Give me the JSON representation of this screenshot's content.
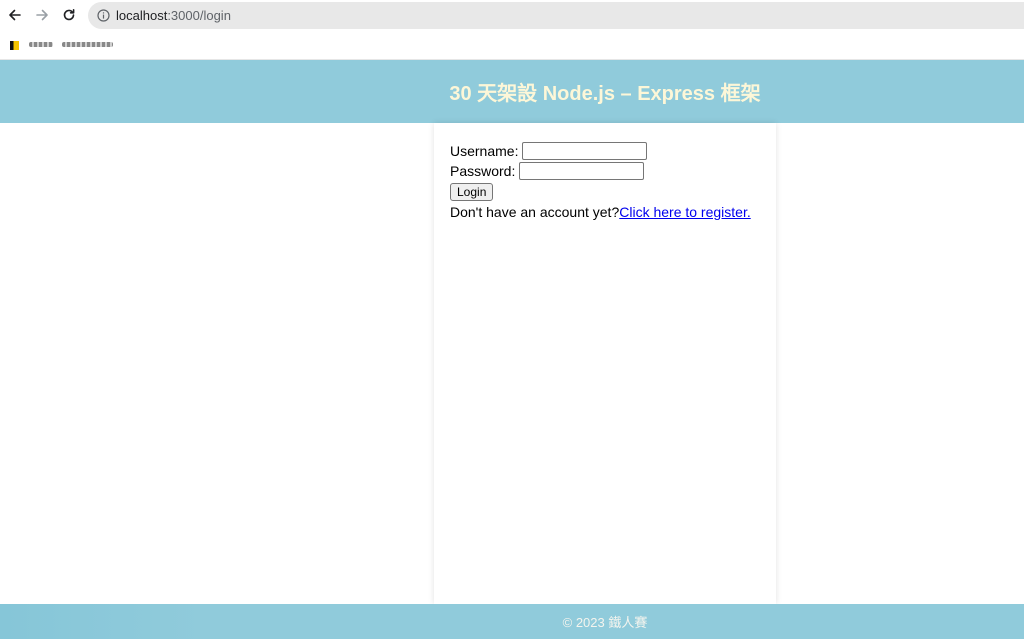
{
  "browser": {
    "url_host": "localhost",
    "url_rest": ":3000/login"
  },
  "header": {
    "title": "30 天架設 Node.js – Express 框架",
    "background": "#90cbdb",
    "title_color": "#fdf7d8"
  },
  "login_form": {
    "username_label": "Username:",
    "username_value": "",
    "password_label": "Password:",
    "password_value": "",
    "login_button": "Login",
    "register_prompt": "Don't have an account yet?",
    "register_link": "Click here to register."
  },
  "footer": {
    "text": "© 2023 鐵人賽"
  },
  "colors": {
    "link": "#0000ee"
  }
}
